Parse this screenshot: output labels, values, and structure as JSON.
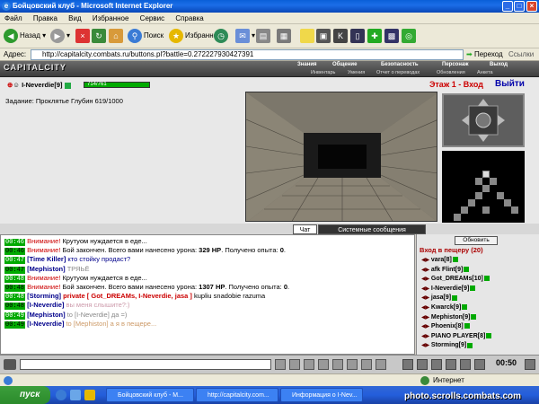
{
  "window": {
    "title": "Бойцовский клуб - Microsoft Internet Explorer"
  },
  "menu": [
    "Файл",
    "Правка",
    "Вид",
    "Избранное",
    "Сервис",
    "Справка"
  ],
  "toolbar": {
    "back": "Назад",
    "search": "Поиск",
    "favorites": "Избранное"
  },
  "address": {
    "label": "Адрес:",
    "url": "http://capitalcity.combats.ru/buttons.pl?battle=0.272227930427391",
    "go": "Переход",
    "links": "Ссылки"
  },
  "game": {
    "logo": "CAPITALCITY",
    "nav_top": [
      "Знания",
      "Общение",
      "Безопасность",
      "Персонаж",
      "Выход"
    ],
    "nav_bottom": [
      "Инвентарь",
      "Умения",
      "Отчет о переводах",
      "Обновления",
      "Анкета"
    ],
    "char": {
      "name": "I-Neverdie",
      "level": "[9]",
      "hp": "714/761"
    },
    "quest": "Задание: Проклятье Глубин 619/1000",
    "floor": "Этаж 1 - Вход",
    "exit": "Выйти",
    "tabs": {
      "chat": "Чат",
      "system": "Системные сообщения"
    }
  },
  "chat": [
    {
      "time": "00:46",
      "parts": [
        {
          "t": "Внимание!",
          "c": "#c00"
        },
        {
          "t": " Крутуом нуждается в еде..."
        }
      ]
    },
    {
      "time": "00:46",
      "parts": [
        {
          "t": "Внимание!",
          "c": "#c00"
        },
        {
          "t": " Бой закончен. Всего вами нанесено урона: "
        },
        {
          "t": "329 HP",
          "b": true
        },
        {
          "t": ". Получено опыта: "
        },
        {
          "t": "0",
          "b": true
        },
        {
          "t": "."
        }
      ]
    },
    {
      "time": "00:47",
      "parts": [
        {
          "t": "[Time Killer]",
          "c": "#00008b",
          "b": true
        },
        {
          "t": " кто стойку продаст?",
          "c": "#00008b"
        }
      ]
    },
    {
      "time": "00:47",
      "parts": [
        {
          "t": "[Mephiston]",
          "c": "#00008b",
          "b": true
        },
        {
          "t": " ТРЯЬЁ",
          "c": "#888"
        }
      ]
    },
    {
      "time": "00:48",
      "parts": [
        {
          "t": "Внимание!",
          "c": "#c00"
        },
        {
          "t": " Крутуом нуждается в еде..."
        }
      ]
    },
    {
      "time": "00:48",
      "parts": [
        {
          "t": "Внимание!",
          "c": "#c00"
        },
        {
          "t": " Бой закончен. Всего вами нанесено урона: "
        },
        {
          "t": "1307 HP",
          "b": true
        },
        {
          "t": ". Получено опыта: "
        },
        {
          "t": "0",
          "b": true
        },
        {
          "t": "."
        }
      ]
    },
    {
      "time": "00:48",
      "parts": [
        {
          "t": "[Storming]",
          "c": "#00008b",
          "b": true
        },
        {
          "t": " private [ Got_DREAMs, I-Neverdie, jasa ]",
          "c": "#c00",
          "b": true
        },
        {
          "t": " kupliu snadobie razuma"
        }
      ]
    },
    {
      "time": "00:48",
      "parts": [
        {
          "t": "[I-Neverdie]",
          "c": "#00008b",
          "b": true
        },
        {
          "t": " вы меня слышите?:)",
          "c": "#c9a"
        }
      ]
    },
    {
      "time": "00:49",
      "parts": [
        {
          "t": "[Mephiston]",
          "c": "#00008b",
          "b": true
        },
        {
          "t": " to [I-Neverdie] да =)",
          "c": "#888"
        }
      ]
    },
    {
      "time": "00:49",
      "parts": [
        {
          "t": "[I-Neverdie]",
          "c": "#00008b",
          "b": true
        },
        {
          "t": " to [Mephiston] а я в пещере...",
          "c": "#c96"
        }
      ]
    }
  ],
  "side": {
    "refresh": "Обновить",
    "header": "Вход в пещеру (20)",
    "users": [
      "vara[8]",
      "afk Flint[9]",
      "Got_DREAMs[10]",
      "I-Neverdie[9]",
      "jasa[9]",
      "Kwarck[9]",
      "Mephiston[9]",
      "Phoenix[8]",
      "PIANO PLAYER[8]",
      "Storming[9]"
    ]
  },
  "bottom": {
    "clock": "00:50"
  },
  "status": {
    "zone": "Интернет"
  },
  "taskbar": {
    "start": "пуск",
    "tasks": [
      "Бойцовский клуб - М...",
      "http://capitalcity.com...",
      "Информация о I-Nev..."
    ]
  },
  "watermark": "photo.scrolls.combats.com"
}
